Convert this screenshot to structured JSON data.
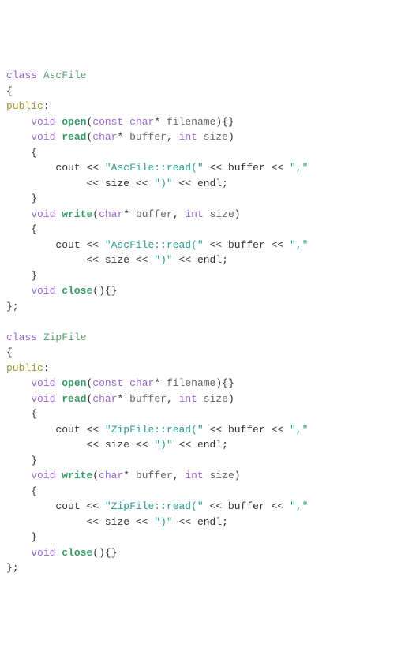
{
  "classes": [
    {
      "kw_class": "class",
      "name": "AscFile",
      "open_brace": "{",
      "access": "public",
      "colon": ":",
      "methods": {
        "open_ret": "void",
        "open_name": "open",
        "open_const": "const",
        "open_ptype": "char",
        "open_star": "*",
        "open_pname": "filename",
        "open_suffix": "){}",
        "read_ret": "void",
        "read_name": "read",
        "read_ptype1": "char",
        "read_star1": "*",
        "read_pname1": "buffer",
        "read_comma": ",",
        "read_ptype2": "int",
        "read_pname2": "size",
        "read_close": ")",
        "read_open_brace": "{",
        "read_cout": "cout",
        "read_op": "<<",
        "read_str1": "\"AscFile::read(\"",
        "read_buf": "buffer",
        "read_str2": "\",\"",
        "read_size": "size",
        "read_str3": "\")\"",
        "read_endl": "endl",
        "read_semi": ";",
        "read_close_brace": "}",
        "write_ret": "void",
        "write_name": "write",
        "write_ptype1": "char",
        "write_star1": "*",
        "write_pname1": "buffer",
        "write_comma": ",",
        "write_ptype2": "int",
        "write_pname2": "size",
        "write_close": ")",
        "write_open_brace": "{",
        "write_cout": "cout",
        "write_op": "<<",
        "write_str1": "\"AscFile::read(\"",
        "write_buf": "buffer",
        "write_str2": "\",\"",
        "write_size": "size",
        "write_str3": "\")\"",
        "write_endl": "endl",
        "write_semi": ";",
        "write_close_brace": "}",
        "close_ret": "void",
        "close_name": "close",
        "close_suffix": "(){}"
      },
      "close_brace": "};"
    },
    {
      "kw_class": "class",
      "name": "ZipFile",
      "open_brace": "{",
      "access": "public",
      "colon": ":",
      "methods": {
        "open_ret": "void",
        "open_name": "open",
        "open_const": "const",
        "open_ptype": "char",
        "open_star": "*",
        "open_pname": "filename",
        "open_suffix": "){}",
        "read_ret": "void",
        "read_name": "read",
        "read_ptype1": "char",
        "read_star1": "*",
        "read_pname1": "buffer",
        "read_comma": ",",
        "read_ptype2": "int",
        "read_pname2": "size",
        "read_close": ")",
        "read_open_brace": "{",
        "read_cout": "cout",
        "read_op": "<<",
        "read_str1": "\"ZipFile::read(\"",
        "read_buf": "buffer",
        "read_str2": "\",\"",
        "read_size": "size",
        "read_str3": "\")\"",
        "read_endl": "endl",
        "read_semi": ";",
        "read_close_brace": "}",
        "write_ret": "void",
        "write_name": "write",
        "write_ptype1": "char",
        "write_star1": "*",
        "write_pname1": "buffer",
        "write_comma": ",",
        "write_ptype2": "int",
        "write_pname2": "size",
        "write_close": ")",
        "write_open_brace": "{",
        "write_cout": "cout",
        "write_op": "<<",
        "write_str1": "\"ZipFile::read(\"",
        "write_buf": "buffer",
        "write_str2": "\",\"",
        "write_size": "size",
        "write_str3": "\")\"",
        "write_endl": "endl",
        "write_semi": ";",
        "write_close_brace": "}",
        "close_ret": "void",
        "close_name": "close",
        "close_suffix": "(){}"
      },
      "close_brace": "};"
    }
  ]
}
